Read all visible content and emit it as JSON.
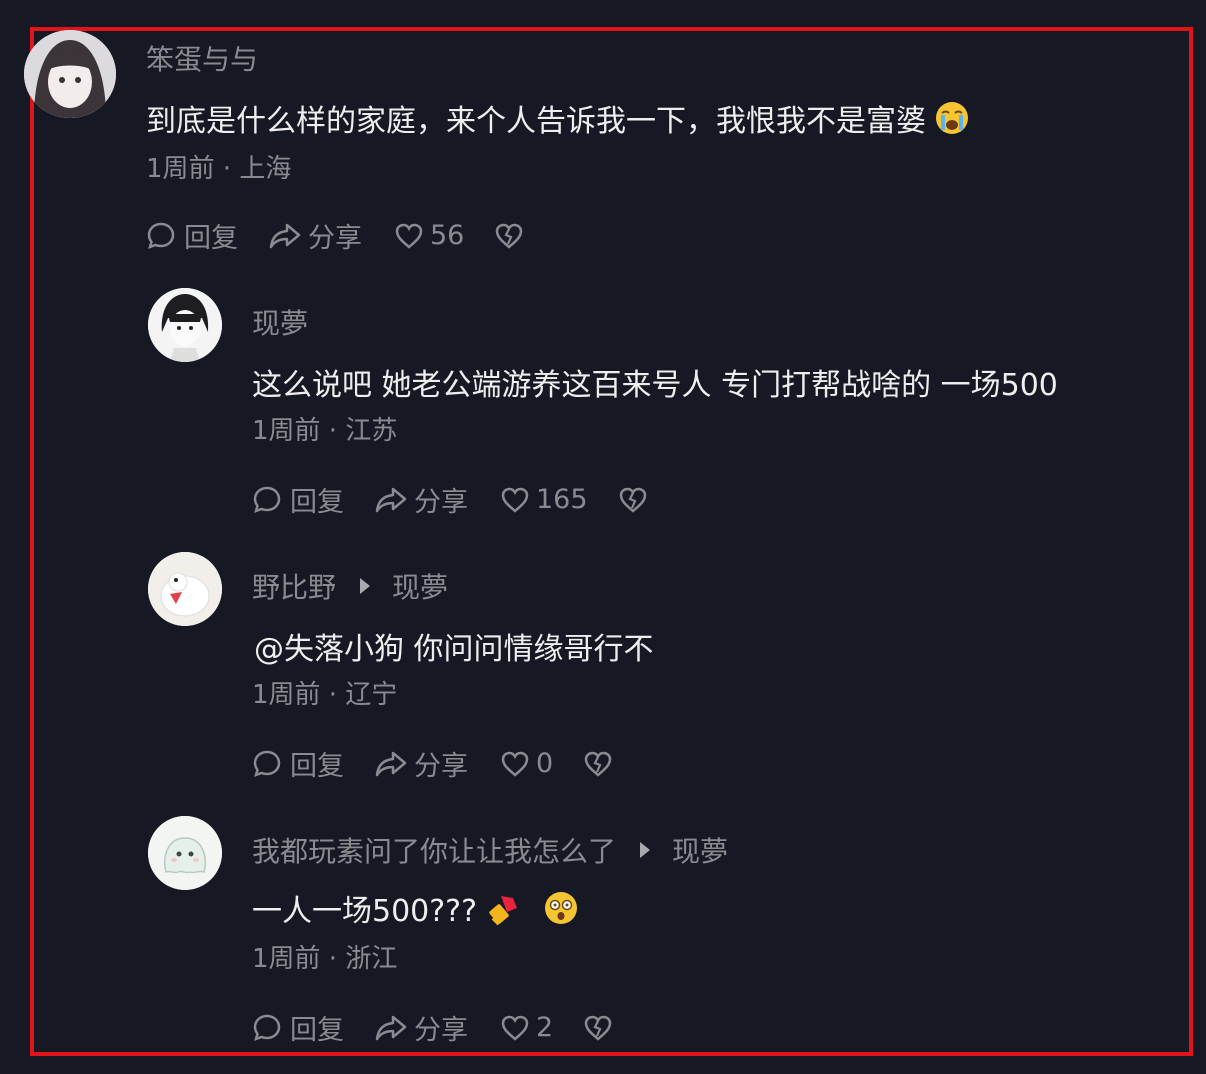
{
  "comments": [
    {
      "author": "笨蛋与与",
      "reply_to": "",
      "text": "到底是什么样的家庭，来个人告诉我一下，我恨我不是富婆",
      "emoji": [
        "crying-face"
      ],
      "meta": "1周前 · 上海",
      "reply_label": "回复",
      "share_label": "分享",
      "likes": "56"
    },
    {
      "author": "现夢",
      "reply_to": "",
      "text": "这么说吧 她老公端游养这百来号人 专门打帮战啥的 一场500",
      "emoji": [],
      "meta": "1周前 · 江苏",
      "reply_label": "回复",
      "share_label": "分享",
      "likes": "165"
    },
    {
      "author": "野比野",
      "reply_to": "现夢",
      "text": "@失落小狗 你问问情缘哥行不",
      "emoji": [],
      "meta": "1周前 · 辽宁",
      "reply_label": "回复",
      "share_label": "分享",
      "likes": "0"
    },
    {
      "author": "我都玩素问了你让让我怎么了",
      "reply_to": "现夢",
      "text": "一人一场500???",
      "emoji": [
        "lipstick",
        "dizzy-face"
      ],
      "meta": "1周前 · 浙江",
      "reply_label": "回复",
      "share_label": "分享",
      "likes": "2"
    }
  ],
  "colors": {
    "background": "#161823",
    "frame": "#e0141a",
    "text_primary": "#eeeeef",
    "text_secondary": "#8a8b91"
  }
}
